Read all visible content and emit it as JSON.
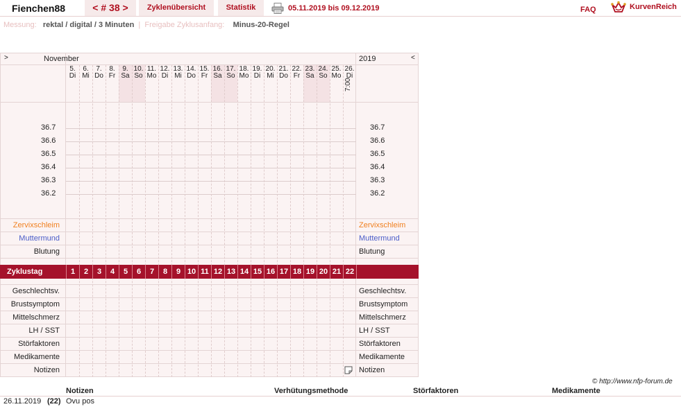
{
  "header": {
    "user": "Fienchen88",
    "cycle_prev": "<",
    "cycle_number": "# 38",
    "cycle_next": ">",
    "tab_overview": "Zyklenübersicht",
    "tab_stats": "Statistik",
    "date_range": "05.11.2019 bis 09.12.2019",
    "faq": "FAQ",
    "logo": "KurvenReich",
    "icons": [
      "printer-icon",
      "crown-logo-icon"
    ]
  },
  "settings": {
    "measure_label": "Messung:",
    "measure_value": "rektal / digital / 3 Minuten",
    "separator": "|",
    "release_label": "Freigabe Zyklusanfang:",
    "release_value": "Minus-20-Regel"
  },
  "chart": {
    "nav_left": ">",
    "month": "November",
    "year": "2019",
    "nav_right": "<",
    "days": [
      {
        "d": "5.",
        "w": "Di"
      },
      {
        "d": "6.",
        "w": "Mi"
      },
      {
        "d": "7.",
        "w": "Do"
      },
      {
        "d": "8.",
        "w": "Fr"
      },
      {
        "d": "9.",
        "w": "Sa"
      },
      {
        "d": "10.",
        "w": "So"
      },
      {
        "d": "11.",
        "w": "Mo"
      },
      {
        "d": "12.",
        "w": "Di"
      },
      {
        "d": "13.",
        "w": "Mi"
      },
      {
        "d": "14.",
        "w": "Do"
      },
      {
        "d": "15.",
        "w": "Fr"
      },
      {
        "d": "16.",
        "w": "Sa"
      },
      {
        "d": "17.",
        "w": "So"
      },
      {
        "d": "18.",
        "w": "Mo"
      },
      {
        "d": "19.",
        "w": "Di"
      },
      {
        "d": "20.",
        "w": "Mi"
      },
      {
        "d": "21.",
        "w": "Do"
      },
      {
        "d": "22.",
        "w": "Fr"
      },
      {
        "d": "23.",
        "w": "Sa"
      },
      {
        "d": "24.",
        "w": "So"
      },
      {
        "d": "25.",
        "w": "Mo"
      },
      {
        "d": "26.",
        "w": "Di"
      }
    ],
    "weekend_days": [
      4,
      5,
      11,
      12,
      18,
      19
    ],
    "last_time": "7:00",
    "temperatures": [
      "36.7",
      "36.6",
      "36.5",
      "36.4",
      "36.3",
      "36.2"
    ],
    "rows_top": [
      {
        "label": "Zervixschleim",
        "color": "orange"
      },
      {
        "label": "Muttermund",
        "color": "blue"
      },
      {
        "label": "Blutung",
        "color": "plain"
      }
    ],
    "cycle_label": "Zyklustag",
    "cycle_days": [
      "1",
      "2",
      "3",
      "4",
      "5",
      "6",
      "7",
      "8",
      "9",
      "10",
      "11",
      "12",
      "13",
      "14",
      "15",
      "16",
      "17",
      "18",
      "19",
      "20",
      "21",
      "22"
    ],
    "rows_bottom": [
      "Geschlechtsv.",
      "Brustsymptom",
      "Mittelschmerz",
      "LH / SST",
      "Störfaktoren",
      "Medikamente",
      "Notizen"
    ]
  },
  "footer": {
    "copyright": "© http://www.nfp-forum.de",
    "headers": [
      "Notizen",
      "Verhütungsmethode",
      "Störfaktoren",
      "Medikamente"
    ],
    "note_date": "26.11.2019",
    "note_day": "(22)",
    "note_text": "Ovu pos"
  },
  "colors": {
    "accent": "#b01020",
    "cycle_bar": "#a5122b",
    "weekend": "#f4e2e4",
    "zervix": "#f08020",
    "muttermund": "#4a5cc8"
  }
}
